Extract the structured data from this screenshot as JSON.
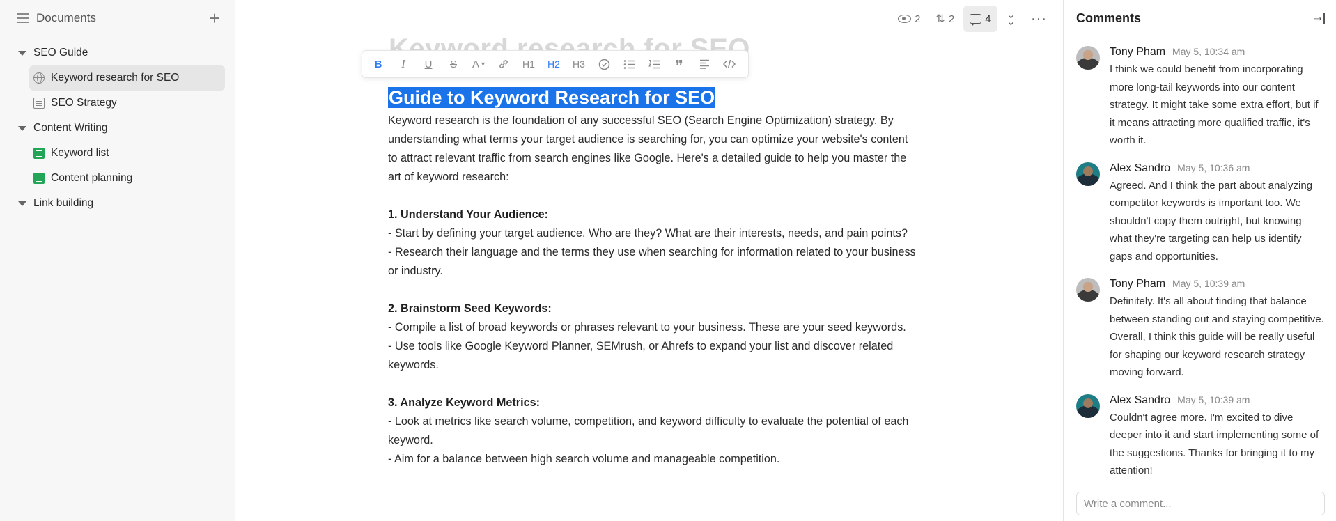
{
  "sidebar": {
    "title": "Documents",
    "add_icon": "plus-icon",
    "tree": [
      {
        "label": "SEO Guide",
        "children": [
          {
            "label": "Keyword research for SEO",
            "icon": "globe-icon",
            "active": true
          },
          {
            "label": "SEO Strategy",
            "icon": "doc-icon"
          }
        ]
      },
      {
        "label": "Content Writing",
        "children": [
          {
            "label": "Keyword list",
            "icon": "sheet-icon"
          },
          {
            "label": "Content planning",
            "icon": "sheet-icon"
          }
        ]
      },
      {
        "label": "Link building",
        "children": []
      }
    ]
  },
  "topbar": {
    "views": "2",
    "changes": "2",
    "comments": "4"
  },
  "editor": {
    "background_title": "Keyword research for SEO",
    "toolbar": {
      "h1": "H1",
      "h2": "H2",
      "h3": "H3",
      "font_color": "A"
    },
    "heading": "Guide to Keyword Research for SEO",
    "intro": "Keyword research is the foundation of any successful SEO (Search Engine Optimization) strategy. By understanding what terms your target audience is searching for, you can optimize your website's content to attract relevant traffic from search engines like Google. Here's a detailed guide to help you master the art of keyword research:",
    "sections": [
      {
        "title": "1. Understand Your Audience:",
        "lines": [
          "- Start by defining your target audience. Who are they? What are their interests, needs, and pain points?",
          "- Research their language and the terms they use when searching for information related to your business or industry."
        ]
      },
      {
        "title": "2. Brainstorm Seed Keywords:",
        "lines": [
          "- Compile a list of broad keywords or phrases relevant to your business. These are your seed keywords.",
          "- Use tools like Google Keyword Planner, SEMrush, or Ahrefs to expand your list and discover related keywords."
        ]
      },
      {
        "title": "3. Analyze Keyword Metrics:",
        "lines": [
          "- Look at metrics like search volume, competition, and keyword difficulty to evaluate the potential of each keyword.",
          "- Aim for a balance between high search volume and manageable competition."
        ]
      }
    ]
  },
  "comments": {
    "title": "Comments",
    "items": [
      {
        "author": "Tony Pham",
        "time": "May 5, 10:34 am",
        "text": "I think we could benefit from incorporating more long-tail keywords into our content strategy. It might take some extra effort, but if it means attracting more qualified traffic, it's worth it."
      },
      {
        "author": "Alex Sandro",
        "time": "May 5, 10:36 am",
        "text": "Agreed. And I think the part about analyzing competitor keywords is important too. We shouldn't copy them outright, but knowing what they're targeting can help us identify gaps and opportunities."
      },
      {
        "author": "Tony Pham",
        "time": "May 5, 10:39 am",
        "text": "Definitely. It's all about finding that balance between standing out and staying competitive. Overall, I think this guide will be really useful for shaping our keyword research strategy moving forward."
      },
      {
        "author": "Alex Sandro",
        "time": "May 5, 10:39 am",
        "text": "Couldn't agree more. I'm excited to dive deeper into it and start implementing some of the suggestions. Thanks for bringing it to my attention!"
      }
    ],
    "input_placeholder": "Write a comment..."
  },
  "colors": {
    "accent": "#2f7df6",
    "selection": "#1a73e8",
    "sheet_icon": "#22a557"
  }
}
